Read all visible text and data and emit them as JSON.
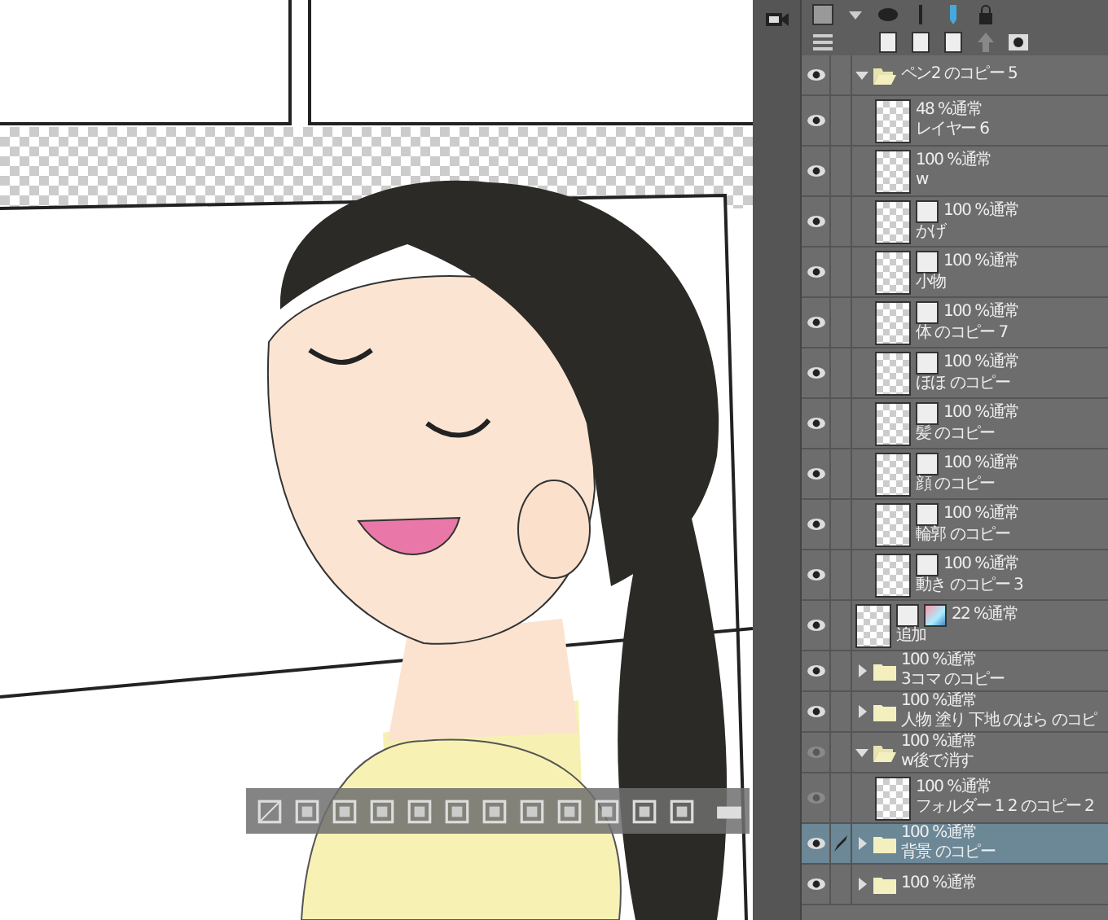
{
  "layers": [
    {
      "kind": "folder",
      "name": "ペン2 のコピー 5",
      "visible": true,
      "expanded": true,
      "selected": false,
      "children": [
        {
          "kind": "layer",
          "opacity": "48 %通常",
          "name": "レイヤー 6",
          "visible": true,
          "selected": false
        },
        {
          "kind": "layer",
          "opacity": "100 %通常",
          "name": "w",
          "visible": true,
          "selected": false
        },
        {
          "kind": "masked",
          "opacity": "100 %通常",
          "name": "かげ",
          "visible": true,
          "selected": false
        },
        {
          "kind": "masked",
          "opacity": "100 %通常",
          "name": "小物",
          "visible": true,
          "selected": false
        },
        {
          "kind": "masked",
          "opacity": "100 %通常",
          "name": "体 のコピー 7",
          "visible": true,
          "selected": false
        },
        {
          "kind": "masked",
          "opacity": "100 %通常",
          "name": "ほほ のコピー",
          "visible": true,
          "selected": false
        },
        {
          "kind": "masked",
          "opacity": "100 %通常",
          "name": "髪 のコピー",
          "visible": true,
          "selected": false
        },
        {
          "kind": "masked",
          "opacity": "100 %通常",
          "name": "顔 のコピー",
          "visible": true,
          "selected": false
        },
        {
          "kind": "masked",
          "opacity": "100 %通常",
          "name": "輪郭 のコピー",
          "visible": true,
          "selected": false
        },
        {
          "kind": "masked",
          "opacity": "100 %通常",
          "name": "動き のコピー 3",
          "visible": true,
          "selected": false
        }
      ]
    },
    {
      "kind": "color",
      "opacity": "22 %通常",
      "name": "追加",
      "visible": true,
      "selected": false
    },
    {
      "kind": "folder",
      "opacity": "100 %通常",
      "name": "3コマ のコピー",
      "visible": true,
      "expanded": false,
      "selected": false
    },
    {
      "kind": "folder",
      "opacity": "100 %通常",
      "name": "人物 塗り 下地 のはら のコピ",
      "visible": true,
      "expanded": false,
      "selected": false
    },
    {
      "kind": "folder",
      "opacity": "100 %通常",
      "name": "w後で消す",
      "visible": false,
      "expanded": true,
      "selected": false,
      "children": [
        {
          "kind": "layer",
          "opacity": "100 %通常",
          "name": "フォルダー 1 2 のコピー 2",
          "visible": false,
          "selected": false
        }
      ]
    },
    {
      "kind": "folder",
      "opacity": "100 %通常",
      "name": "背景 のコピー",
      "visible": true,
      "expanded": false,
      "selected": true
    },
    {
      "kind": "folder",
      "opacity": "100 %通常",
      "visible": true,
      "expanded": false,
      "selected": false
    }
  ]
}
